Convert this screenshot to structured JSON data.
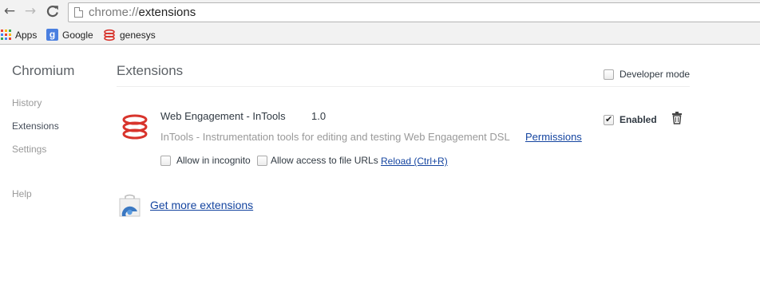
{
  "toolbar": {
    "back_icon": "back-arrow-icon",
    "forward_icon": "forward-arrow-icon",
    "reload_icon": "reload-icon",
    "url_scheme": "chrome://",
    "url_path": "extensions"
  },
  "bookmarks": [
    {
      "label": "Apps",
      "icon": "apps-grid-icon"
    },
    {
      "label": "Google",
      "icon": "google-icon"
    },
    {
      "label": "genesys",
      "icon": "genesys-icon"
    }
  ],
  "sidebar": {
    "title": "Chromium",
    "items": [
      {
        "label": "History"
      },
      {
        "label": "Extensions"
      },
      {
        "label": "Settings"
      },
      {
        "label": "Help"
      }
    ]
  },
  "main": {
    "title": "Extensions",
    "developer_mode_label": "Developer mode",
    "developer_mode_checked": false,
    "extension": {
      "name": "Web Engagement - InTools",
      "version": "1.0",
      "description": "InTools - Instrumentation tools for editing and testing Web Engagement DSL",
      "permissions_link": "Permissions",
      "incognito_label": "Allow in incognito",
      "incognito_checked": false,
      "file_urls_label": "Allow access to file URLs",
      "file_urls_checked": false,
      "reload_link": "Reload (Ctrl+R)",
      "enabled_label": "Enabled",
      "enabled_checked": true,
      "icon": "genesys-logo-icon",
      "delete_icon": "trash-icon"
    },
    "get_more_link": "Get more extensions",
    "store_icon": "web-store-icon"
  },
  "colors": {
    "link": "#1545a0",
    "muted_text": "#999999",
    "brand_red": "#d8342c",
    "chrome_bar": "#f2f2f2"
  }
}
